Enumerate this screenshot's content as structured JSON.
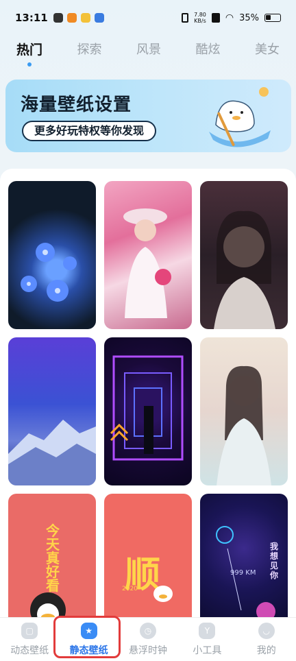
{
  "status_bar": {
    "time": "13:11",
    "speed_top": "7.80",
    "speed_bottom": "KB/s",
    "battery": "35%"
  },
  "tabs": [
    {
      "label": "热门",
      "active": true
    },
    {
      "label": "探索",
      "active": false
    },
    {
      "label": "风景",
      "active": false
    },
    {
      "label": "酷炫",
      "active": false
    },
    {
      "label": "美女",
      "active": false
    }
  ],
  "banner": {
    "title": "海量壁纸设置",
    "button": "更多好玩特权等你发现"
  },
  "wallpapers": {
    "w7_text": "今天真好看",
    "w8_text": "顺",
    "w8_year": "2020",
    "w9_text": "我想见你",
    "w9_km": "999 KM"
  },
  "bottom_nav": [
    {
      "label": "动态壁纸",
      "icon": "lock-icon",
      "active": false
    },
    {
      "label": "静态壁纸",
      "icon": "wallpaper-icon",
      "active": true
    },
    {
      "label": "悬浮时钟",
      "icon": "clock-icon",
      "active": false
    },
    {
      "label": "小工具",
      "icon": "tool-icon",
      "active": false
    },
    {
      "label": "我的",
      "icon": "smile-icon",
      "active": false
    }
  ],
  "colors": {
    "accent": "#3a8cf5",
    "highlight_box": "#e23b3b"
  }
}
